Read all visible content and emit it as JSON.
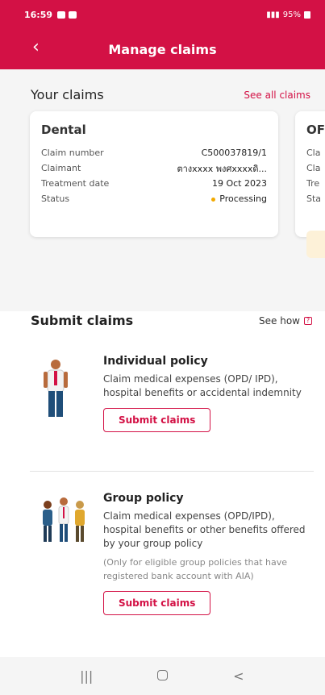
{
  "status_bar": {
    "time": "16:59",
    "battery": "95%"
  },
  "app_bar": {
    "title": "Manage claims",
    "back_icon": "chevron-left-icon"
  },
  "your_claims": {
    "heading": "Your claims",
    "see_all_label": "See all claims",
    "cards": [
      {
        "title": "Dental",
        "rows": [
          {
            "label": "Claim number",
            "value": "C500037819/1"
          },
          {
            "label": "Claimant",
            "value": "ตางxxxx พงศxxxxดิ..."
          },
          {
            "label": "Treatment date",
            "value": "19 Oct 2023"
          },
          {
            "label": "Status",
            "value": "Processing",
            "status_color": "#f2a900"
          }
        ]
      },
      {
        "title": "OF",
        "rows": [
          {
            "label": "Cla"
          },
          {
            "label": "Cla"
          },
          {
            "label": "Tre"
          },
          {
            "label": "Sta"
          }
        ]
      }
    ]
  },
  "submit_claims": {
    "heading": "Submit claims",
    "see_how_label": "See how",
    "policies": [
      {
        "title": "Individual policy",
        "description": "Claim medical expenses (OPD/ IPD), hospital benefits or accidental indemnity",
        "button_label": "Submit claims"
      },
      {
        "title": "Group policy",
        "description": "Claim medical expenses (OPD/IPD), hospital benefits or other benefits offered by your group policy",
        "note": "(Only for eligible group policies that have registered bank account with AIA)",
        "button_label": "Submit claims"
      }
    ]
  },
  "nav_bar": {
    "recents_icon": "|||",
    "home_icon": "home-icon",
    "back_icon": "<"
  },
  "colors": {
    "brand": "#d31145",
    "status_processing": "#f2a900"
  }
}
